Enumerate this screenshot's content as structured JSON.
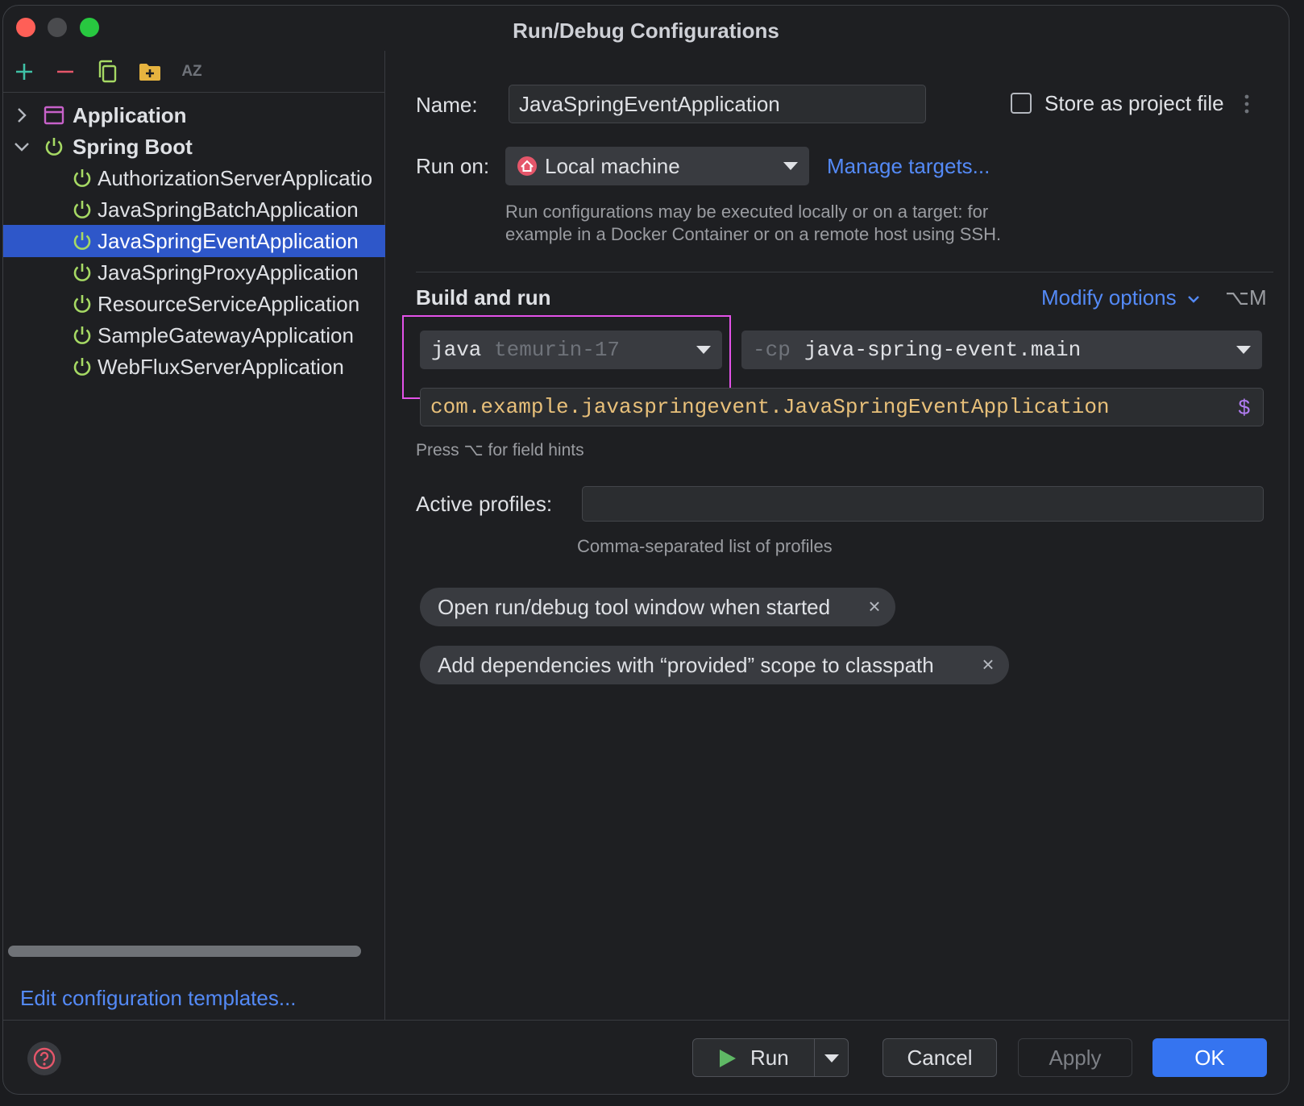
{
  "window": {
    "title": "Run/Debug Configurations"
  },
  "toolbar": {
    "icons": [
      "add-icon",
      "remove-icon",
      "copy-icon",
      "new-folder-icon",
      "sort-alphabetically-icon"
    ],
    "sort_label": "AZ"
  },
  "tree": {
    "groups": [
      {
        "label": "Application",
        "expanded": false,
        "icon": "application-icon"
      },
      {
        "label": "Spring Boot",
        "expanded": true,
        "icon": "spring-boot-icon"
      }
    ],
    "items": [
      {
        "label": "AuthorizationServerApplicatio"
      },
      {
        "label": "JavaSpringBatchApplication"
      },
      {
        "label": "JavaSpringEventApplication",
        "selected": true
      },
      {
        "label": "JavaSpringProxyApplication"
      },
      {
        "label": "ResourceServiceApplication"
      },
      {
        "label": "SampleGatewayApplication"
      },
      {
        "label": "WebFluxServerApplication"
      }
    ],
    "edit_templates": "Edit configuration templates..."
  },
  "form": {
    "name_label": "Name:",
    "name_value": "JavaSpringEventApplication",
    "store_label": "Store as project file",
    "store_checked": false,
    "run_on_label": "Run on:",
    "run_on_value": "Local machine",
    "manage_targets": "Manage targets...",
    "run_on_hint_1": "Run configurations may be executed locally or on a target: for",
    "run_on_hint_2": "example in a Docker Container or on a remote host using SSH.",
    "build_and_run": "Build and run",
    "modify_options": "Modify options",
    "modify_shortcut": "⌥M",
    "jdk_prefix": "java",
    "jdk_value": "temurin-17",
    "cp_prefix": "-cp",
    "cp_value": "java-spring-event.main",
    "main_class": "com.example.javaspringevent.JavaSpringEventApplication",
    "main_class_icon": "$",
    "field_hint": "Press ⌥ for field hints",
    "profiles_label": "Active profiles:",
    "profiles_value": "",
    "profiles_hint": "Comma-separated list of profiles",
    "chips": [
      {
        "label": "Open run/debug tool window when started"
      },
      {
        "label": "Add dependencies with “provided” scope to classpath"
      }
    ]
  },
  "footer": {
    "help_icon": "help-icon",
    "run": "Run",
    "cancel": "Cancel",
    "apply": "Apply",
    "ok": "OK"
  },
  "colors": {
    "accent": "#3574f0",
    "link": "#548af7",
    "spring_green": "#a6d964",
    "selection": "#2e57c9",
    "highlight": "#e352e8"
  }
}
